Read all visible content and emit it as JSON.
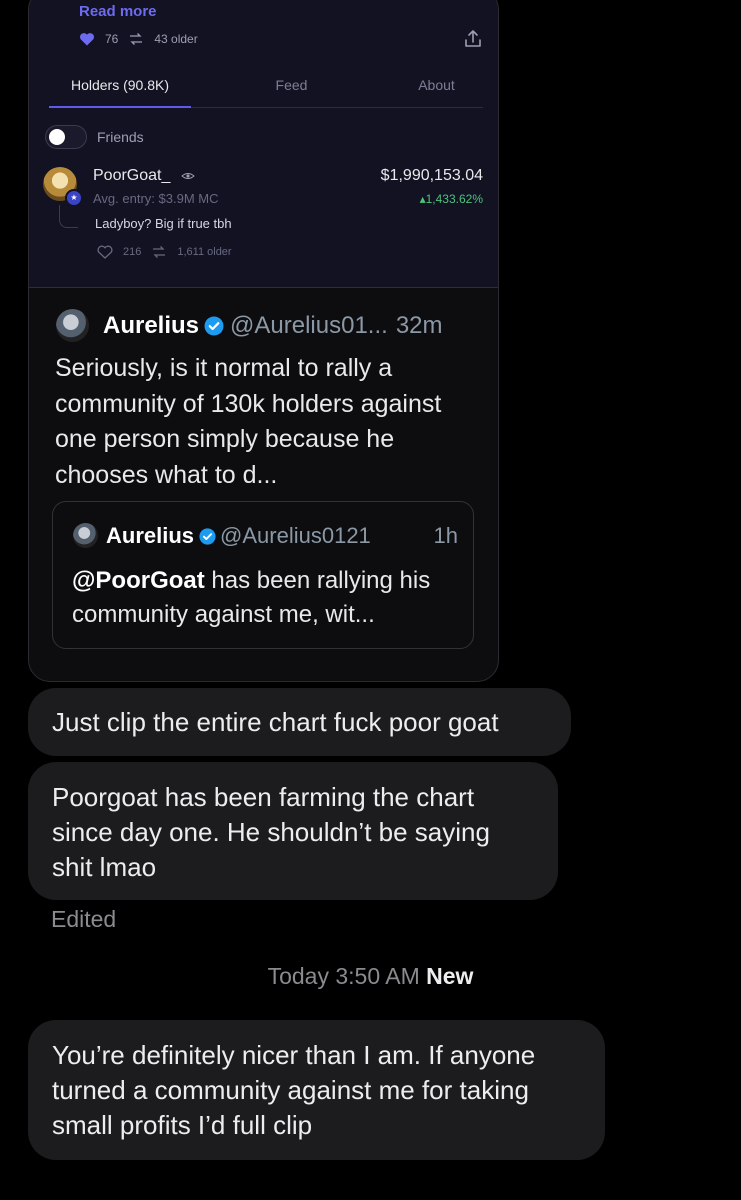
{
  "shared_post": {
    "read_more": "Read more",
    "likes": "76",
    "reposts": "43 older",
    "tabs": [
      {
        "label": "Holders (90.8K)"
      },
      {
        "label": "Feed"
      },
      {
        "label": "About"
      }
    ],
    "friends_toggle_label": "Friends",
    "holder": {
      "name": "PoorGoat_",
      "avg_entry": "Avg. entry: $3.9M MC",
      "value": "$1,990,153.04",
      "gain": "▴1,433.62%",
      "comment": "Ladyboy? Big if true tbh",
      "likes": "216",
      "reposts": "1,611 older"
    }
  },
  "tweet": {
    "name": "Aurelius",
    "handle": "@Aurelius01...",
    "time": "32m",
    "body": "Seriously, is it normal to rally a community of 130k holders against one person simply because he chooses what to d...",
    "quote": {
      "name": "Aurelius",
      "handle": "@Aurelius0121",
      "time": "1h",
      "mention": "@PoorGoat",
      "body": " has been rallying his community against me, wit..."
    }
  },
  "messages": [
    {
      "text": "Just clip the entire chart fuck poor goat"
    },
    {
      "text": "Poorgoat has been farming the chart since day one. He shouldn’t be saying shit lmao"
    },
    {
      "text": "You’re definitely nicer than I am. If anyone turned a community against me for taking small profits I’d full clip"
    }
  ],
  "edited_label": "Edited",
  "timestamp": {
    "time": "Today 3:50 AM",
    "new_label": "New"
  },
  "colors": {
    "background": "#000000",
    "bubble": "#1c1c1e",
    "panel": "#121223",
    "accent": "#5d5be8",
    "gain_green": "#4ec27a",
    "verified_blue": "#1d9bf0"
  }
}
